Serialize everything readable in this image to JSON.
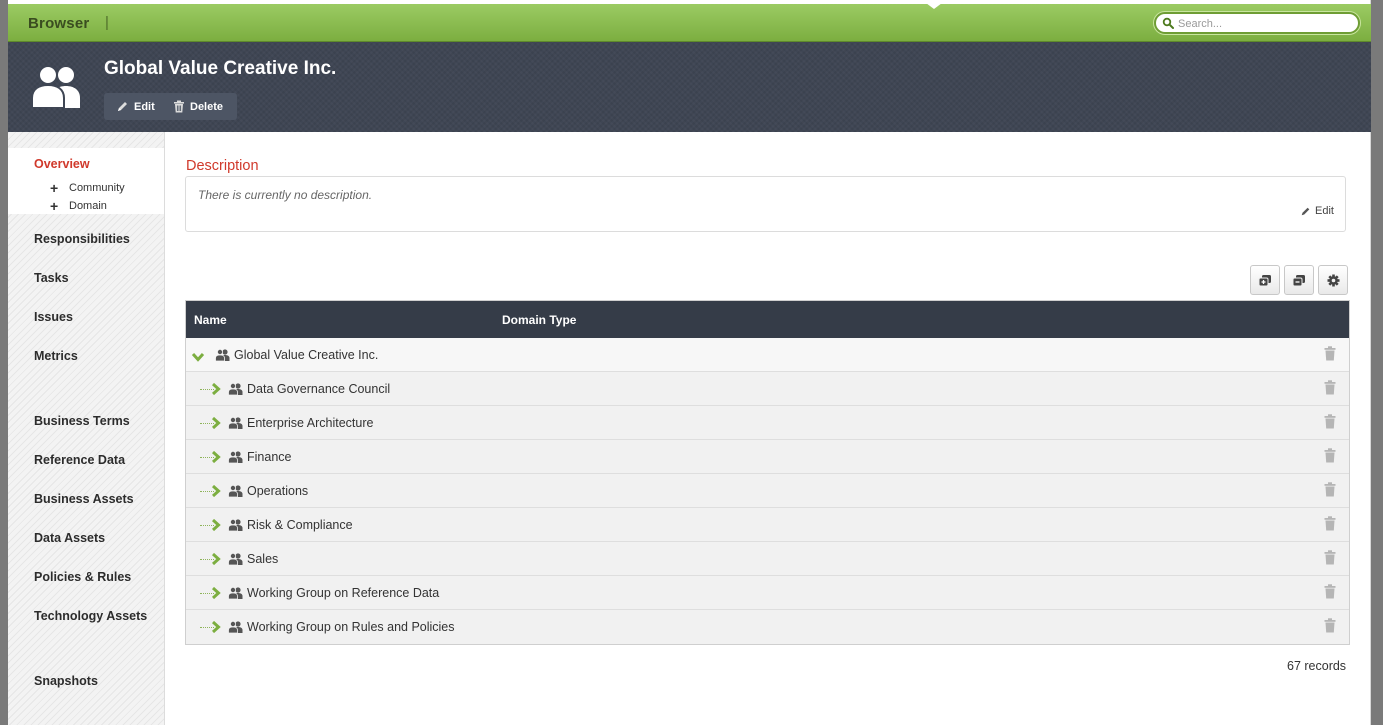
{
  "topbar": {
    "brand": "Browser",
    "separator": "|",
    "search_placeholder": "Search..."
  },
  "header": {
    "title": "Global Value Creative Inc.",
    "edit_label": "Edit",
    "delete_label": "Delete"
  },
  "sidebar": {
    "overview": "Overview",
    "sub_items": [
      "Community",
      "Domain"
    ],
    "items": [
      "Responsibilities",
      "Tasks",
      "Issues",
      "Metrics",
      "Business Terms",
      "Reference Data",
      "Business Assets",
      "Data Assets",
      "Policies & Rules",
      "Technology Assets",
      "Snapshots"
    ]
  },
  "description": {
    "title": "Description",
    "text": "There is currently no description.",
    "edit_label": "Edit"
  },
  "table": {
    "columns": [
      "Name",
      "Domain Type"
    ],
    "root": "Global Value Creative Inc.",
    "rows": [
      "Data Governance Council",
      "Enterprise Architecture",
      "Finance",
      "Operations",
      "Risk & Compliance",
      "Sales",
      "Working Group on Reference Data",
      "Working Group on Rules and Policies"
    ],
    "records": "67 records"
  },
  "icons": {
    "search": "search-icon",
    "avatar": "community-icon",
    "edit": "pencil-icon",
    "delete": "trash-icon",
    "expand_all": "expand-all-icon",
    "collapse_all": "collapse-all-icon",
    "settings": "gear-icon",
    "row": "people-icon"
  },
  "colors": {
    "topbar_green": "#8bbd50",
    "header_dark": "#3f4654",
    "accent_red": "#d0392b",
    "table_header": "#353c48",
    "tree_green": "#7cae40"
  }
}
